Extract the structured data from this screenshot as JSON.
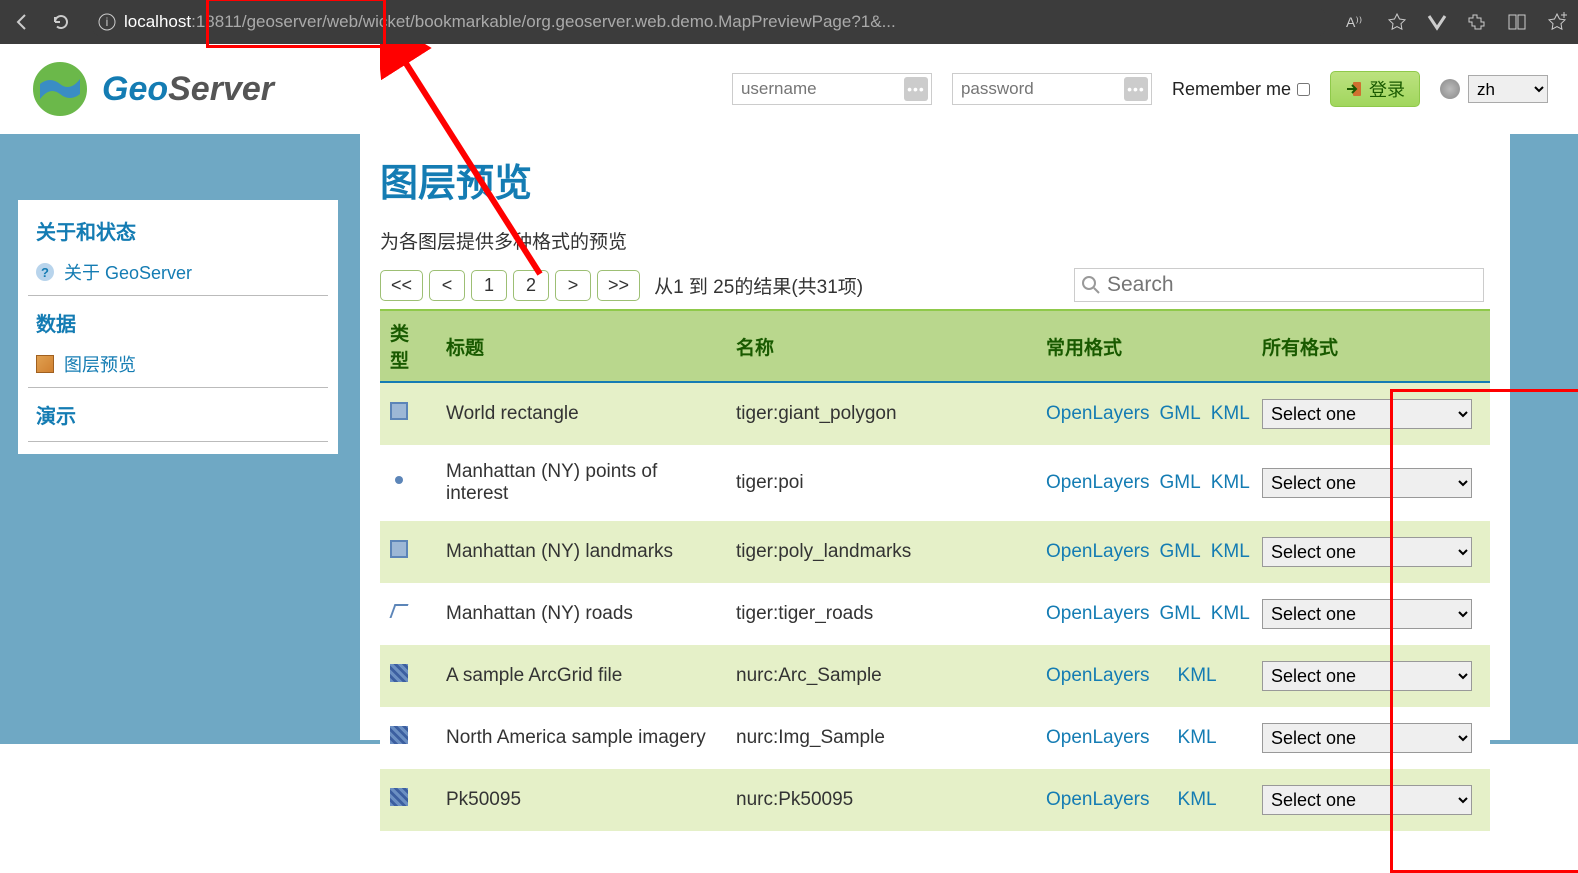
{
  "browser": {
    "url_host": "localhost",
    "url_rest": ":18811/geoserver/web/wicket/bookmarkable/org.geoserver.web.demo.MapPreviewPage?1&..."
  },
  "header": {
    "brand_geo": "Geo",
    "brand_server": "Server",
    "username_placeholder": "username",
    "password_placeholder": "password",
    "remember_label": "Remember me",
    "login_label": "登录",
    "lang_value": "zh"
  },
  "sidebar": {
    "group_about": "关于和状态",
    "about_geoserver": "关于 GeoServer",
    "group_data": "数据",
    "layer_preview": "图层预览",
    "group_demo": "演示"
  },
  "page": {
    "title": "图层预览",
    "subtitle": "为各图层提供多种格式的预览",
    "pager_first": "<<",
    "pager_prev": "<",
    "pager_p1": "1",
    "pager_p2": "2",
    "pager_next": ">",
    "pager_last": ">>",
    "pager_status": "从1 到 25的结果(共31项)",
    "search_placeholder": "Search"
  },
  "table": {
    "headers": {
      "type": "类型",
      "title": "标题",
      "name": "名称",
      "common": "常用格式",
      "all": "所有格式"
    },
    "link_ol": "OpenLayers",
    "link_gml": "GML",
    "link_kml": "KML",
    "select_default": "Select one",
    "rows": [
      {
        "icon": "poly",
        "title": "World rectangle",
        "name": "tiger:giant_polygon",
        "gml": true
      },
      {
        "icon": "pt",
        "title": "Manhattan (NY) points of interest",
        "name": "tiger:poi",
        "gml": true
      },
      {
        "icon": "poly",
        "title": "Manhattan (NY) landmarks",
        "name": "tiger:poly_landmarks",
        "gml": true
      },
      {
        "icon": "ln",
        "title": "Manhattan (NY) roads",
        "name": "tiger:tiger_roads",
        "gml": true
      },
      {
        "icon": "raster",
        "title": "A sample ArcGrid file",
        "name": "nurc:Arc_Sample",
        "gml": false
      },
      {
        "icon": "raster",
        "title": "North America sample imagery",
        "name": "nurc:Img_Sample",
        "gml": false
      },
      {
        "icon": "raster",
        "title": "Pk50095",
        "name": "nurc:Pk50095",
        "gml": false
      }
    ]
  }
}
